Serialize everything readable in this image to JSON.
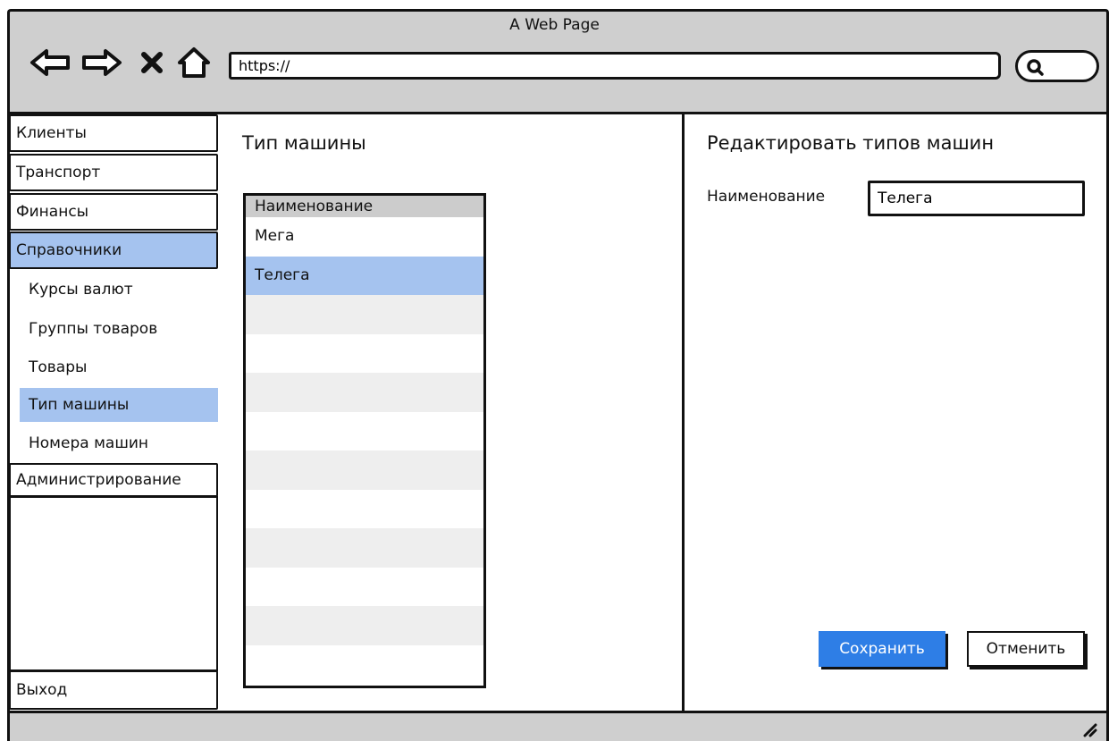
{
  "window": {
    "title": "A Web Page"
  },
  "browser": {
    "url": "https://",
    "nav_icons": [
      "back-arrow-icon",
      "forward-arrow-icon",
      "close-x-icon",
      "home-icon",
      "search-icon"
    ]
  },
  "sidebar": {
    "items": [
      {
        "label": "Клиенты"
      },
      {
        "label": "Транспорт"
      },
      {
        "label": "Финансы"
      },
      {
        "label": "Справочники",
        "active": true
      }
    ],
    "subitems": [
      {
        "label": "Курсы валют"
      },
      {
        "label": "Группы товаров"
      },
      {
        "label": "Товары"
      },
      {
        "label": "Тип машины",
        "active": true
      },
      {
        "label": "Номера машин"
      }
    ],
    "admin_label": "Администрирование",
    "logout_label": "Выход"
  },
  "list_panel": {
    "title": "Тип машины",
    "column_header": "Наименование",
    "rows": [
      "Мега",
      "Телега"
    ],
    "selected_row": "Телега"
  },
  "edit_panel": {
    "title": "Редактировать типов машин",
    "name_label": "Наименование",
    "name_value": "Телега",
    "save_label": "Сохранить",
    "cancel_label": "Отменить"
  },
  "colors": {
    "chrome": "#cfcfcf",
    "highlight": "#a5c3ef",
    "primary_button": "#2e7ee6",
    "row_stripe": "#eeeeee",
    "list_header": "#cccccc"
  }
}
